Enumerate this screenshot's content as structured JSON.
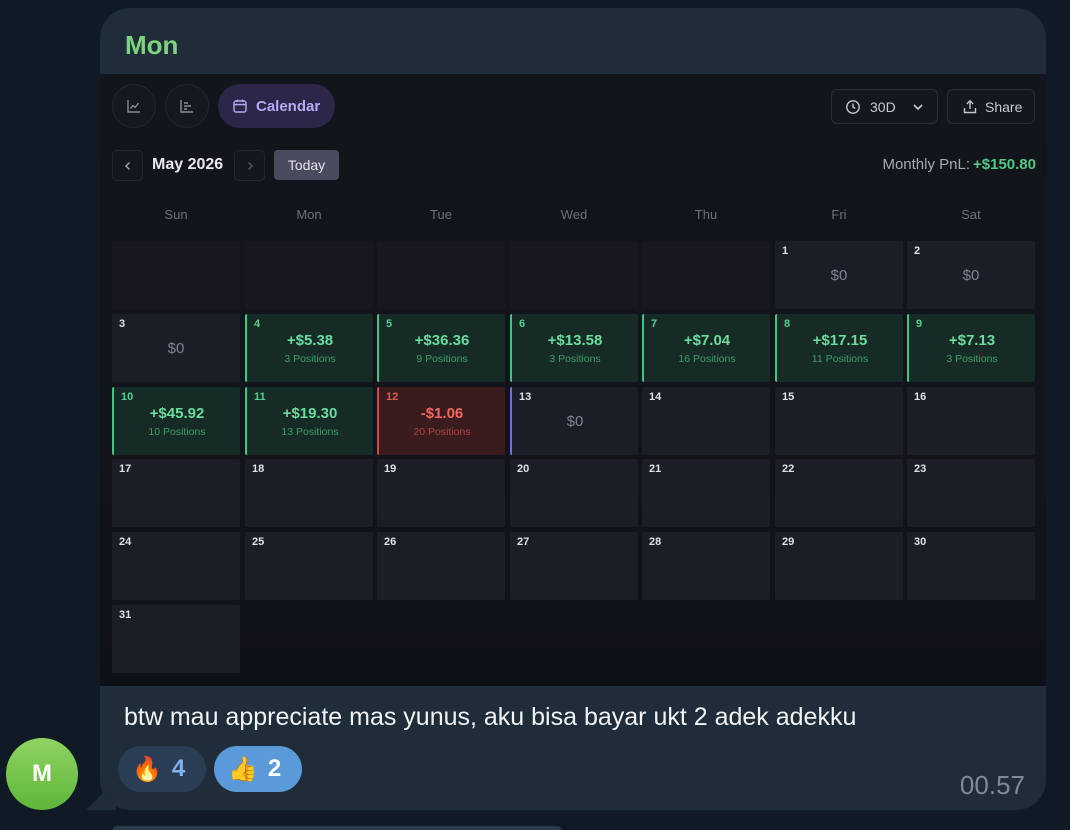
{
  "avatar": {
    "initial": "M",
    "color": "#6cc04a"
  },
  "sender": {
    "name": "Mon",
    "color": "#7ed47c"
  },
  "toolbar": {
    "line_chart_icon": "line-chart-icon",
    "bar_chart_icon": "bar-chart-icon",
    "calendar_label": "Calendar",
    "range_label": "30D",
    "share_label": "Share"
  },
  "calendar": {
    "month_label": "May 2026",
    "today_label": "Today",
    "monthly_pnl_label": "Monthly PnL:",
    "monthly_pnl_value": "+$150.80",
    "weekdays": [
      "Sun",
      "Mon",
      "Tue",
      "Wed",
      "Thu",
      "Fri",
      "Sat"
    ],
    "days": [
      {
        "day": "1",
        "status": "zero",
        "amount": "$0",
        "positions": ""
      },
      {
        "day": "2",
        "status": "zero",
        "amount": "$0",
        "positions": ""
      },
      {
        "day": "3",
        "status": "zero",
        "amount": "$0",
        "positions": ""
      },
      {
        "day": "4",
        "status": "gain",
        "amount": "+$5.38",
        "positions": "3 Positions"
      },
      {
        "day": "5",
        "status": "gain",
        "amount": "+$36.36",
        "positions": "9 Positions"
      },
      {
        "day": "6",
        "status": "gain",
        "amount": "+$13.58",
        "positions": "3 Positions"
      },
      {
        "day": "7",
        "status": "gain",
        "amount": "+$7.04",
        "positions": "16 Positions"
      },
      {
        "day": "8",
        "status": "gain",
        "amount": "+$17.15",
        "positions": "11 Positions"
      },
      {
        "day": "9",
        "status": "gain",
        "amount": "+$7.13",
        "positions": "3 Positions"
      },
      {
        "day": "10",
        "status": "gain",
        "amount": "+$45.92",
        "positions": "10 Positions"
      },
      {
        "day": "11",
        "status": "gain",
        "amount": "+$19.30",
        "positions": "13 Positions"
      },
      {
        "day": "12",
        "status": "loss",
        "amount": "-$1.06",
        "positions": "20 Positions"
      },
      {
        "day": "13",
        "status": "today",
        "amount": "$0",
        "positions": ""
      },
      {
        "day": "14",
        "status": "empty",
        "amount": "",
        "positions": ""
      },
      {
        "day": "15",
        "status": "empty",
        "amount": "",
        "positions": ""
      },
      {
        "day": "16",
        "status": "empty",
        "amount": "",
        "positions": ""
      },
      {
        "day": "17",
        "status": "empty",
        "amount": "",
        "positions": ""
      },
      {
        "day": "18",
        "status": "empty",
        "amount": "",
        "positions": ""
      },
      {
        "day": "19",
        "status": "empty",
        "amount": "",
        "positions": ""
      },
      {
        "day": "20",
        "status": "empty",
        "amount": "",
        "positions": ""
      },
      {
        "day": "21",
        "status": "empty",
        "amount": "",
        "positions": ""
      },
      {
        "day": "22",
        "status": "empty",
        "amount": "",
        "positions": ""
      },
      {
        "day": "23",
        "status": "empty",
        "amount": "",
        "positions": ""
      },
      {
        "day": "24",
        "status": "empty",
        "amount": "",
        "positions": ""
      },
      {
        "day": "25",
        "status": "empty",
        "amount": "",
        "positions": ""
      },
      {
        "day": "26",
        "status": "empty",
        "amount": "",
        "positions": ""
      },
      {
        "day": "27",
        "status": "empty",
        "amount": "",
        "positions": ""
      },
      {
        "day": "28",
        "status": "empty",
        "amount": "",
        "positions": ""
      },
      {
        "day": "29",
        "status": "empty",
        "amount": "",
        "positions": ""
      },
      {
        "day": "30",
        "status": "empty",
        "amount": "",
        "positions": ""
      },
      {
        "day": "31",
        "status": "empty",
        "amount": "",
        "positions": ""
      }
    ]
  },
  "message": {
    "text": "btw mau appreciate mas yunus, aku bisa bayar ukt 2 adek adekku",
    "time": "00.57"
  },
  "reactions": [
    {
      "emoji": "🔥",
      "icon": "fire-icon",
      "count": "4"
    },
    {
      "emoji": "👍",
      "icon": "thumbs-up-icon",
      "count": "2"
    }
  ],
  "colors": {
    "gain": "#4ec986",
    "loss": "#e05a52",
    "accent": "#b9a9f2",
    "today_border": "#7a68e8"
  }
}
